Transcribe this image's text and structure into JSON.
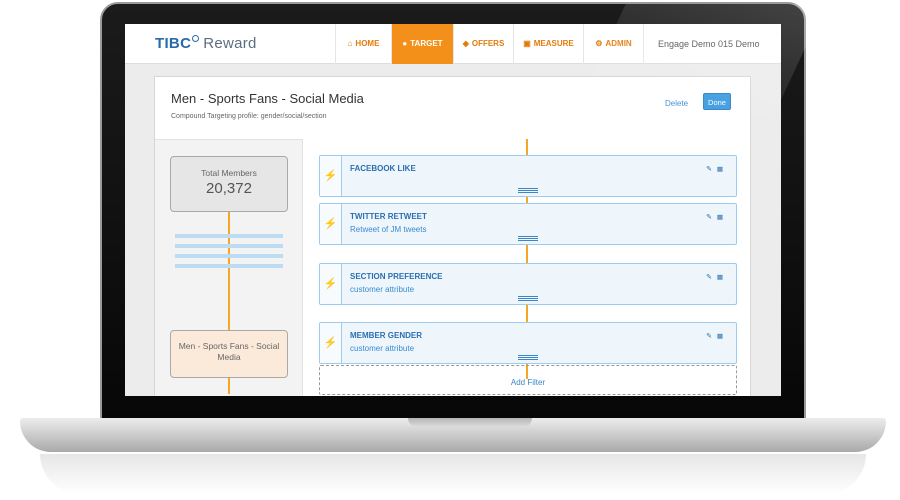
{
  "app": {
    "brand_tibco": "TIBC",
    "brand_reward": "Reward"
  },
  "nav": {
    "items": [
      {
        "label": "HOME",
        "icon": "home-icon",
        "active": false
      },
      {
        "label": "TARGET",
        "icon": "users-icon",
        "active": true
      },
      {
        "label": "OFFERS",
        "icon": "tag-icon",
        "active": false
      },
      {
        "label": "MEASURE",
        "icon": "chart-icon",
        "active": false
      },
      {
        "label": "ADMIN",
        "icon": "gears-icon",
        "active": false
      }
    ],
    "account": "Engage Demo 015 Demo",
    "accent_color": "#f39019"
  },
  "panel": {
    "title": "Men - Sports Fans - Social Media",
    "subtitle": "Compound Targeting profile: gender/social/section",
    "delete_label": "Delete",
    "done_label": "Done"
  },
  "summary": {
    "members_label": "Total Members",
    "members_value": "20,372",
    "segment_label": "Men - Sports Fans - Social Media"
  },
  "criteria": [
    {
      "title": "FACEBOOK LIKE",
      "subtitle": ""
    },
    {
      "title": "TWITTER RETWEET",
      "subtitle": "Retweet of JM tweets"
    },
    {
      "title": "SECTION PREFERENCE",
      "subtitle": "customer attribute"
    },
    {
      "title": "MEMBER GENDER",
      "subtitle": "customer attribute"
    }
  ],
  "add_filter_label": "Add Filter"
}
